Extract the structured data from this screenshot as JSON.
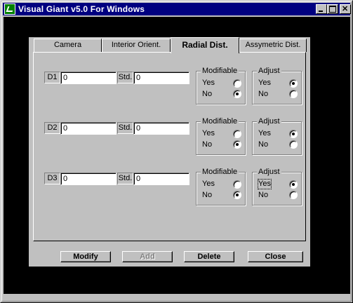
{
  "window": {
    "title": "Visual Giant v5.0 For Windows"
  },
  "tabs": [
    "Camera",
    "Interior Orient.",
    "Radial Dist.",
    "Assymetric Dist."
  ],
  "active_tab": "Radial Dist.",
  "std_label": "Std.",
  "modifiable_title": "Modifiable",
  "adjust_title": "Adjust",
  "yes_label": "Yes",
  "no_label": "No",
  "params": [
    {
      "label": "D1",
      "value": "0",
      "std": "0",
      "modifiable": "No",
      "adjust": "Yes"
    },
    {
      "label": "D2",
      "value": "0",
      "std": "0",
      "modifiable": "No",
      "adjust": "Yes"
    },
    {
      "label": "D3",
      "value": "0",
      "std": "0",
      "modifiable": "No",
      "adjust": "Yes"
    }
  ],
  "buttons": {
    "modify": "Modify",
    "add": "Add",
    "delete": "Delete",
    "close": "Close"
  },
  "add_enabled": false,
  "colors": {
    "titlebar": "#000080",
    "face": "#c0c0c0",
    "background": "#000000"
  }
}
